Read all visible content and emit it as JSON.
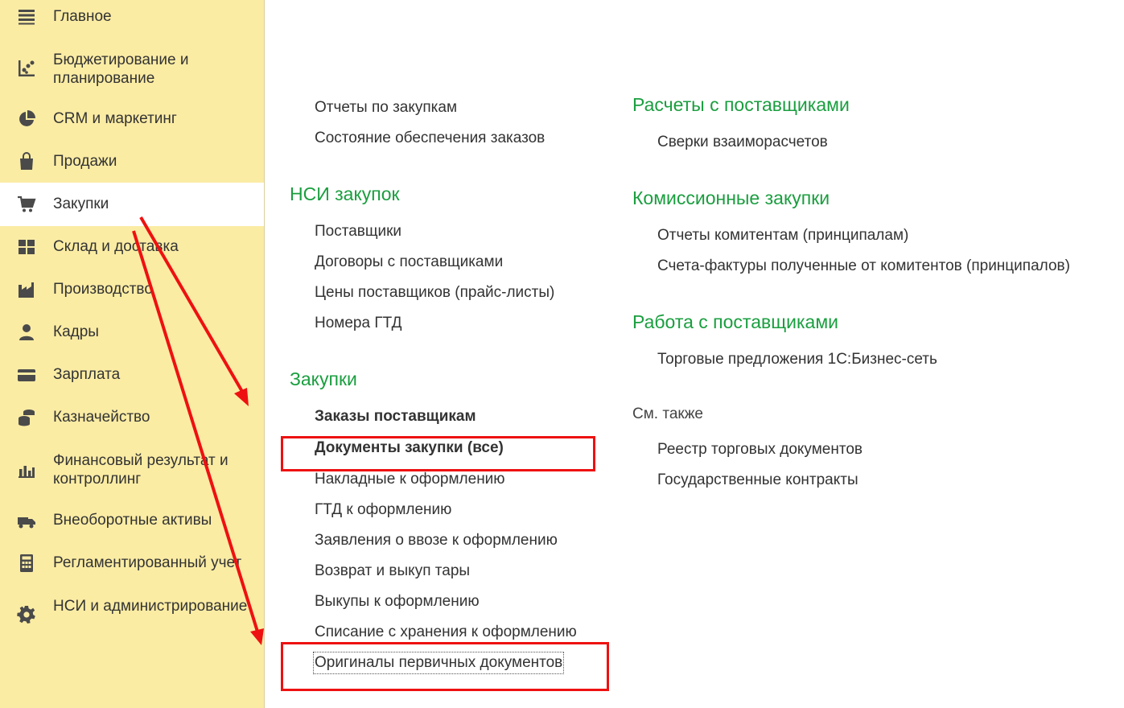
{
  "sidebar": {
    "items": [
      {
        "label": "Главное",
        "icon": "menu-lines-icon",
        "active": false
      },
      {
        "label": "Бюджетирование и планирование",
        "icon": "budget-chart-icon",
        "active": false
      },
      {
        "label": "CRM и маркетинг",
        "icon": "pie-chart-icon",
        "active": false
      },
      {
        "label": "Продажи",
        "icon": "shopping-bag-icon",
        "active": false
      },
      {
        "label": "Закупки",
        "icon": "shopping-cart-icon",
        "active": true
      },
      {
        "label": "Склад и доставка",
        "icon": "warehouse-grid-icon",
        "active": false
      },
      {
        "label": "Производство",
        "icon": "factory-icon",
        "active": false
      },
      {
        "label": "Кадры",
        "icon": "person-icon",
        "active": false
      },
      {
        "label": "Зарплата",
        "icon": "wallet-card-icon",
        "active": false
      },
      {
        "label": "Казначейство",
        "icon": "coins-stack-icon",
        "active": false
      },
      {
        "label": "Финансовый результат и контроллинг",
        "icon": "bar-chart-icon",
        "active": false
      },
      {
        "label": "Внеоборотные активы",
        "icon": "truck-icon",
        "active": false
      },
      {
        "label": "Регламентированный учет",
        "icon": "calculator-icon",
        "active": false
      },
      {
        "label": "НСИ и администрирование",
        "icon": "gear-icon",
        "active": false
      }
    ]
  },
  "content": {
    "left_column": {
      "reports": [
        "Отчеты по закупкам",
        "Состояние обеспечения заказов"
      ],
      "nsi_title": "НСИ закупок",
      "nsi_items": [
        "Поставщики",
        "Договоры с поставщиками",
        "Цены поставщиков (прайс-листы)",
        "Номера ГТД"
      ],
      "purchases_title": "Закупки",
      "purchases_items": [
        "Заказы поставщикам",
        "Документы закупки (все)",
        "Накладные к оформлению",
        "ГТД к оформлению",
        "Заявления о ввозе к оформлению",
        "Возврат и выкуп тары",
        "Выкупы к оформлению",
        "Списание с хранения к оформлению",
        "Оригиналы первичных документов"
      ]
    },
    "right_column": {
      "settlements_title": "Расчеты с поставщиками",
      "settlements_items": [
        "Сверки взаиморасчетов"
      ],
      "commission_title": "Комиссионные закупки",
      "commission_items": [
        "Отчеты комитентам (принципалам)",
        "Счета-фактуры полученные от комитентов (принципалов)"
      ],
      "work_title": "Работа с поставщиками",
      "work_items": [
        "Торговые предложения 1С:Бизнес-сеть"
      ],
      "see_also_label": "См. также",
      "see_also_items": [
        "Реестр торговых документов",
        "Государственные контракты"
      ]
    }
  },
  "colors": {
    "sidebar_bg": "#fbeca4",
    "group_title": "#1a9e3f",
    "annotation": "#ee1111"
  }
}
